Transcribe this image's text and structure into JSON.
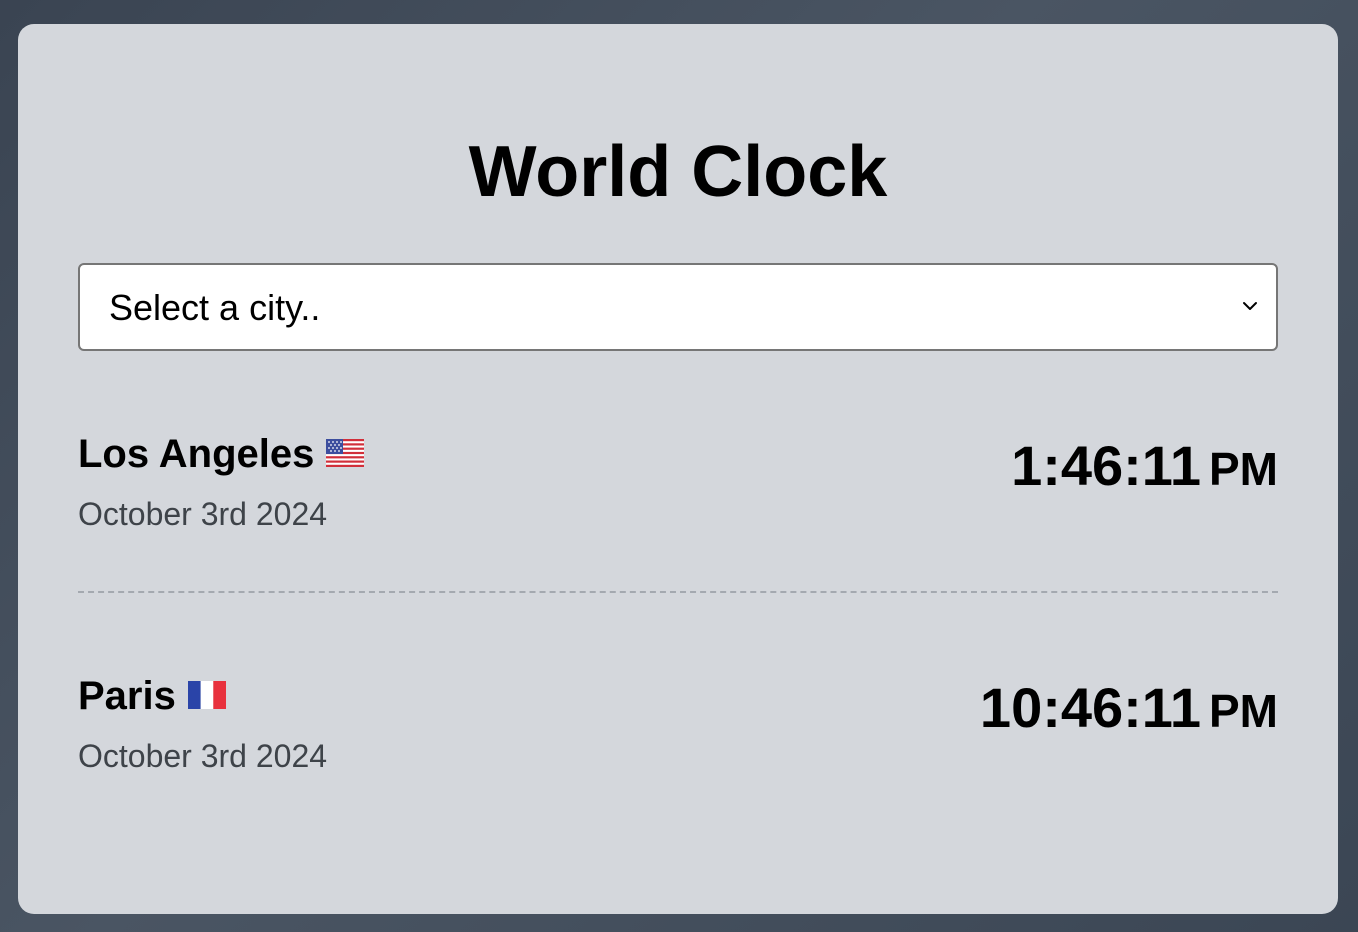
{
  "app": {
    "title": "World Clock"
  },
  "city_select": {
    "selected_label": "Select a city..",
    "icon": "chevron-down-icon"
  },
  "cities": [
    {
      "name": "Los Angeles",
      "flag_icon": "us-flag-icon",
      "date": "October 3rd 2024",
      "time": "1:46:11",
      "ampm": "PM"
    },
    {
      "name": "Paris",
      "flag_icon": "france-flag-icon",
      "date": "October 3rd 2024",
      "time": "10:46:11",
      "ampm": "PM"
    }
  ],
  "colors": {
    "page_background": "#3f4957",
    "card_background": "#d4d7dc",
    "date_text": "#3e4349",
    "divider": "#a4a9b0",
    "us_flag_red": "#d12f3a",
    "us_flag_blue": "#3c4e9e",
    "fr_flag_blue": "#2a44a8",
    "fr_flag_red": "#e8313d"
  }
}
